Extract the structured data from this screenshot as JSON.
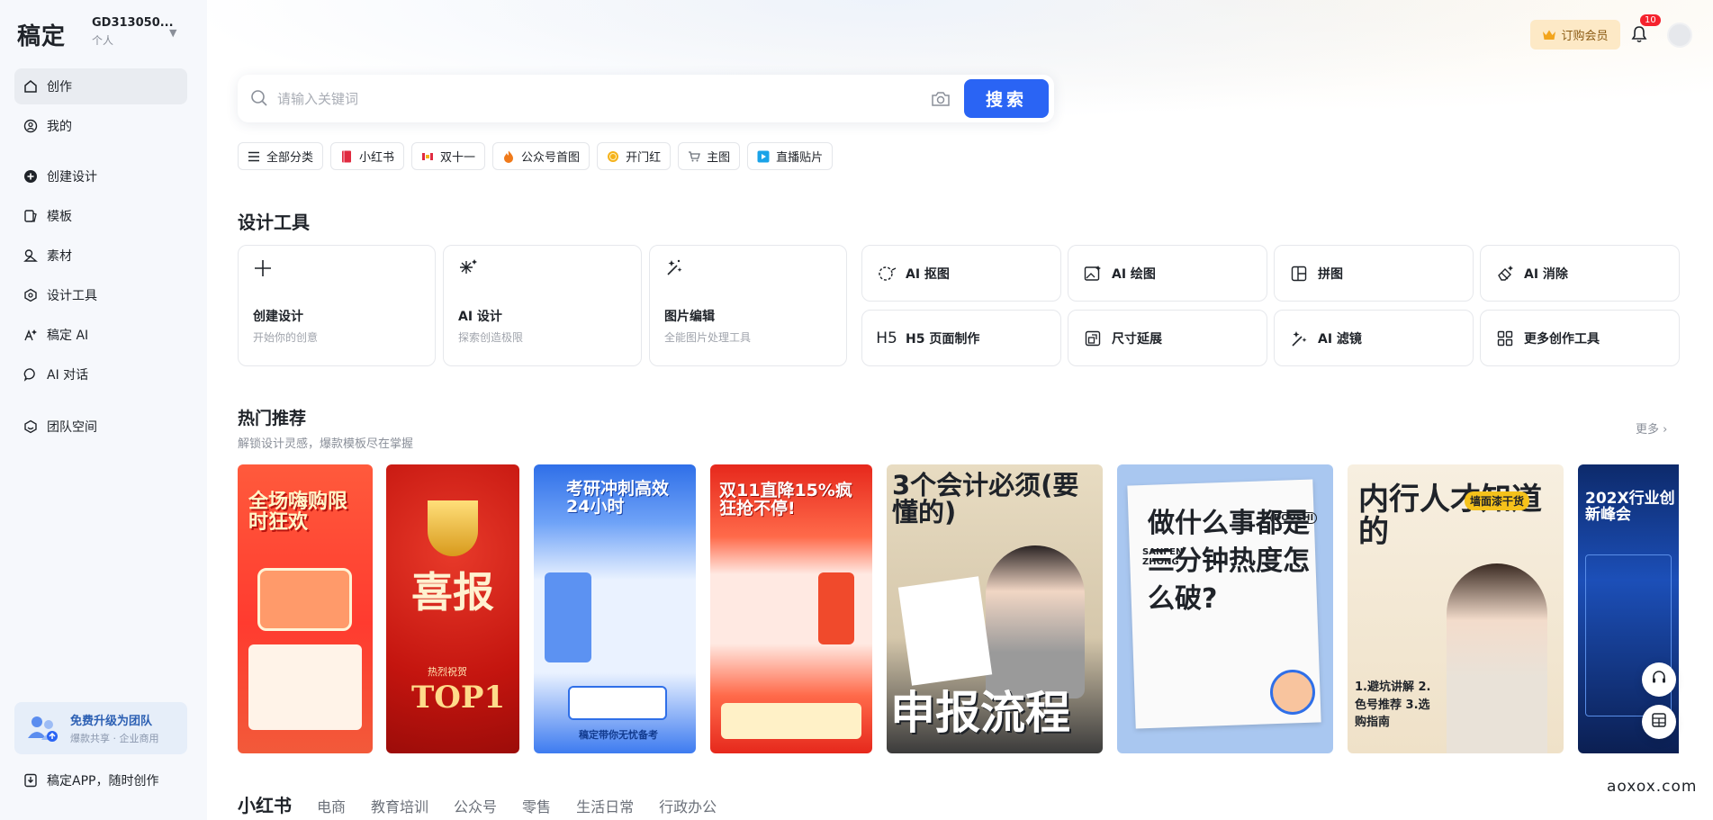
{
  "sidebar": {
    "logo": "稿定",
    "account_name": "GD313050...",
    "account_type": "个人",
    "items": [
      {
        "label": "创作",
        "icon": "home-icon",
        "active": true
      },
      {
        "label": "我的",
        "icon": "user-icon"
      },
      {
        "label": "创建设计",
        "icon": "plus-circle-icon"
      },
      {
        "label": "模板",
        "icon": "template-icon"
      },
      {
        "label": "素材",
        "icon": "material-icon"
      },
      {
        "label": "设计工具",
        "icon": "tools-icon"
      },
      {
        "label": "稿定 AI",
        "icon": "ai-icon"
      },
      {
        "label": "AI 对话",
        "icon": "chat-icon"
      },
      {
        "label": "团队空间",
        "icon": "team-icon"
      }
    ],
    "upgrade_title": "免费升级为团队",
    "upgrade_sub": "爆款共享 · 企业商用",
    "app_label": "稿定APP，随时创作"
  },
  "topbar": {
    "vip_label": "订购会员",
    "notification_count": "10"
  },
  "search": {
    "placeholder": "请输入关键词",
    "button_label": "搜索"
  },
  "chips": [
    {
      "label": "全部分类",
      "icon": "menu-icon",
      "color": "#1f2329"
    },
    {
      "label": "小红书",
      "icon": "xiaohongshu-icon",
      "color": "#e02b40"
    },
    {
      "label": "双十一",
      "icon": "double11-icon",
      "color": "#e02b40"
    },
    {
      "label": "公众号首图",
      "icon": "fire-icon",
      "color": "#f07a1a"
    },
    {
      "label": "开门红",
      "icon": "coin-icon",
      "color": "#f5b21b"
    },
    {
      "label": "主图",
      "icon": "cart-icon",
      "color": "#6b7079"
    },
    {
      "label": "直播贴片",
      "icon": "live-icon",
      "color": "#1aa3e8"
    }
  ],
  "design_tools": {
    "title": "设计工具",
    "big": [
      {
        "title": "创建设计",
        "sub": "开始你的创意",
        "icon": "plus-icon"
      },
      {
        "title": "AI 设计",
        "sub": "探索创造极限",
        "icon": "sparkle-icon"
      },
      {
        "title": "图片编辑",
        "sub": "全能图片处理工具",
        "icon": "magic-wand-icon"
      }
    ],
    "small": [
      {
        "label": "AI 抠图",
        "icon": "cutout-icon"
      },
      {
        "label": "AI 绘图",
        "icon": "image-draw-icon"
      },
      {
        "label": "拼图",
        "icon": "collage-icon"
      },
      {
        "label": "AI 消除",
        "icon": "eraser-icon"
      },
      {
        "label": "H5 页面制作",
        "icon": "h5-icon"
      },
      {
        "label": "尺寸延展",
        "icon": "resize-icon"
      },
      {
        "label": "AI 滤镜",
        "icon": "filter-icon"
      },
      {
        "label": "更多创作工具",
        "icon": "grid-icon"
      }
    ]
  },
  "hot": {
    "title": "热门推荐",
    "subtitle": "解锁设计灵感，爆款模板尽在掌握",
    "more_label": "更多",
    "cards": [
      {
        "text": "全场嗨购限时狂欢"
      },
      {
        "text": "喜报",
        "text2": "热烈祝贺",
        "text3": "TOP1"
      },
      {
        "text": "考研冲刺高效24小时",
        "text2": "稿定带你无忧备考"
      },
      {
        "text": "双11直降15%疯狂抢不停!"
      },
      {
        "text": "3个会计必须(要懂的)",
        "text2": "申报流程"
      },
      {
        "text": "做什么事都是三分钟热度怎么破?",
        "text2": "SANFEN ZHONG",
        "text3": "DOUSHI"
      },
      {
        "text": "内行人才知道的",
        "text2": "墙面漆干货",
        "text3": "1.避坑讲解 2.色号推荐 3.选购指南"
      },
      {
        "text": "202X行业创新峰会"
      }
    ]
  },
  "categories": {
    "items": [
      "小红书",
      "电商",
      "教育培训",
      "公众号",
      "零售",
      "生活日常",
      "行政办公"
    ]
  },
  "watermark": "aoxox.com"
}
